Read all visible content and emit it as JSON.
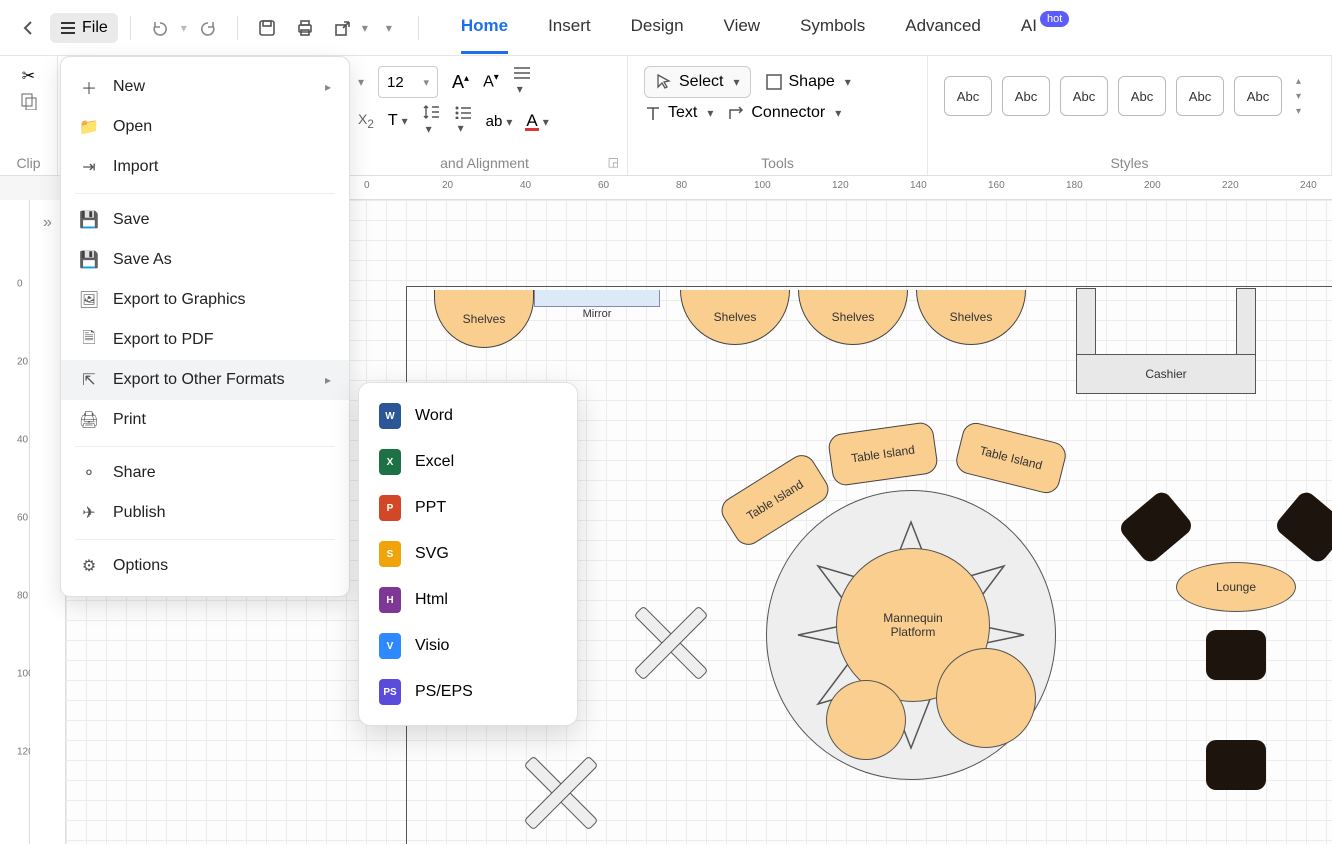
{
  "topbar": {
    "file_label": "File"
  },
  "tabs": [
    "Home",
    "Insert",
    "Design",
    "View",
    "Symbols",
    "Advanced",
    "AI"
  ],
  "ai_badge": "hot",
  "ribbon": {
    "clip_label": "Clip",
    "font_label": "and Alignment",
    "font_size": "12",
    "tools_label": "Tools",
    "select_label": "Select",
    "shape_label": "Shape",
    "text_label": "Text",
    "connector_label": "Connector",
    "styles_label": "Styles",
    "style_swatch_text": "Abc"
  },
  "ruler_h": [
    "0",
    "20",
    "40",
    "60",
    "80",
    "100",
    "120",
    "140",
    "160",
    "180",
    "200",
    "220",
    "240"
  ],
  "ruler_v": [
    "0",
    "20",
    "40",
    "60",
    "80",
    "100",
    "120"
  ],
  "file_menu": {
    "new": "New",
    "open": "Open",
    "import": "Import",
    "save": "Save",
    "save_as": "Save As",
    "export_graphics": "Export to Graphics",
    "export_pdf": "Export to PDF",
    "export_other": "Export to Other Formats",
    "print": "Print",
    "share": "Share",
    "publish": "Publish",
    "options": "Options"
  },
  "export_submenu": [
    "Word",
    "Excel",
    "PPT",
    "SVG",
    "Html",
    "Visio",
    "PS/EPS"
  ],
  "floorplan": {
    "shelves": "Shelves",
    "mirror": "Mirror",
    "cashier": "Cashier",
    "table_island": "Table Island",
    "mannequin": "Mannequin\nPlatform",
    "lounge": "Lounge"
  }
}
